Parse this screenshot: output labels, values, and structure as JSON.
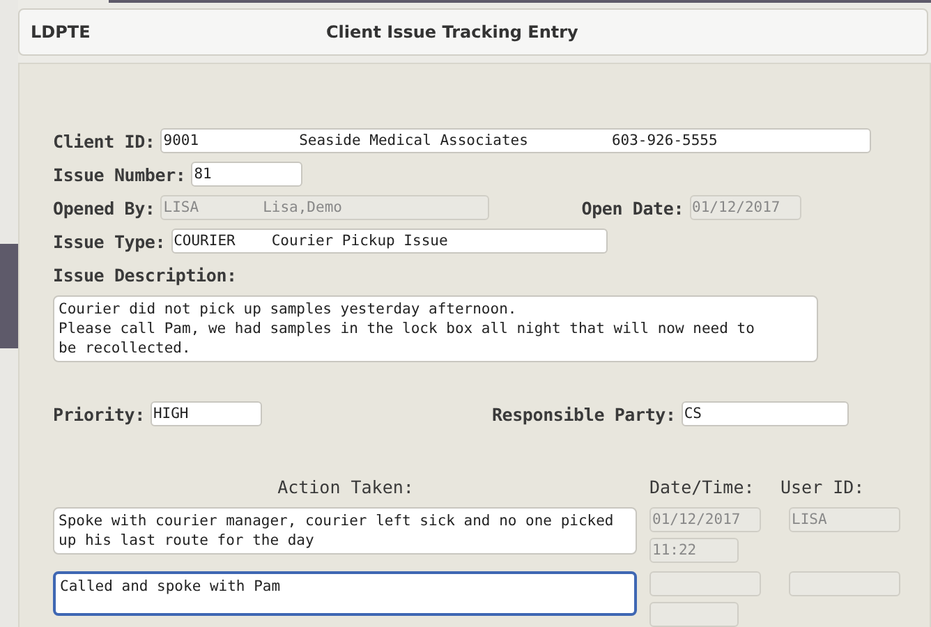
{
  "header": {
    "code": "LDPTE",
    "title": "Client Issue Tracking Entry"
  },
  "client": {
    "label": "Client ID:",
    "id": "9001",
    "name": "Seaside Medical Associates",
    "phone": "603-926-5555",
    "disabled": false
  },
  "issue_number": {
    "label": "Issue Number:",
    "value": "81",
    "disabled": false
  },
  "opened_by": {
    "label": "Opened By:",
    "user": "LISA",
    "name": "Lisa,Demo",
    "disabled": true
  },
  "open_date": {
    "label": "Open Date:",
    "value": "01/12/2017",
    "disabled": true
  },
  "issue_type": {
    "label": "Issue Type:",
    "code": "COURIER",
    "name": "Courier Pickup Issue",
    "disabled": false
  },
  "description": {
    "label": "Issue Description:",
    "lines": [
      "Courier did not pick up samples yesterday afternoon.",
      "Please call Pam, we had samples in the lock box all night that will now need to",
      "be recollected."
    ]
  },
  "priority": {
    "label": "Priority:",
    "value": "HIGH",
    "disabled": false
  },
  "responsible_party": {
    "label": "Responsible Party:",
    "value": "CS",
    "disabled": false
  },
  "actions": {
    "columns": [
      "Action Taken:",
      "Date/Time:",
      "User ID:"
    ],
    "rows": [
      {
        "text": "Spoke with courier manager, courier left sick and no one picked up his last route for the day",
        "date": "01/12/2017",
        "time": "11:22",
        "user": "LISA",
        "focused": false
      },
      {
        "text": "Called and spoke with Pam",
        "date": "",
        "time": "",
        "user": "",
        "focused": true
      }
    ]
  }
}
